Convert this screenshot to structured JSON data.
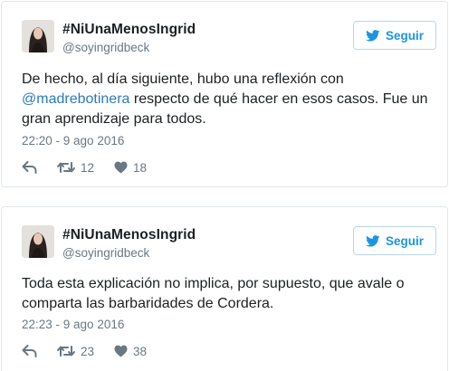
{
  "colors": {
    "accent": "#1b95e0",
    "mention": "#2b7bb9",
    "secondary_text": "#697882",
    "border": "#e1e8ed"
  },
  "tweets": [
    {
      "display_name": "#NiUnaMenosIngrid",
      "handle": "@soyingridbeck",
      "follow_label": "Seguir",
      "text_before": "De hecho, al día siguiente, hubo una reflexión con ",
      "mention": "@madrebotinera",
      "text_after": " respecto de qué hacer en esos casos. Fue un gran aprendizaje para todos.",
      "timestamp": "22:20 - 9 ago 2016",
      "retweets": "12",
      "likes": "18",
      "icons": [
        "reply-icon",
        "retweet-icon",
        "heart-icon",
        "twitter-bird-icon"
      ]
    },
    {
      "display_name": "#NiUnaMenosIngrid",
      "handle": "@soyingridbeck",
      "follow_label": "Seguir",
      "text": "Toda esta explicación no implica, por supuesto, que avale o comparta las barbaridades de Cordera.",
      "timestamp": "22:23 - 9 ago 2016",
      "retweets": "23",
      "likes": "38",
      "icons": [
        "reply-icon",
        "retweet-icon",
        "heart-icon",
        "twitter-bird-icon"
      ]
    }
  ]
}
